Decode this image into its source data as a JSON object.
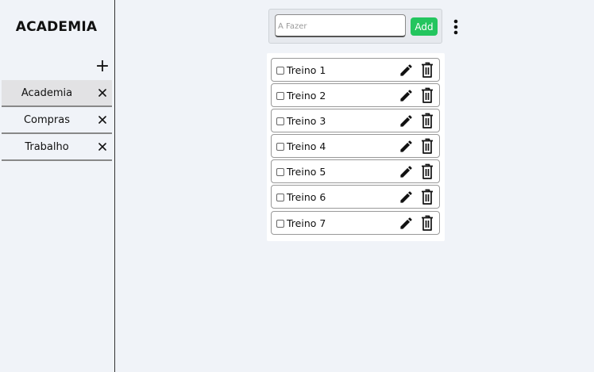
{
  "sidebar": {
    "title": "ACADEMIA",
    "add_list_label": "+",
    "lists": [
      {
        "label": "Academia",
        "active": true
      },
      {
        "label": "Compras",
        "active": false
      },
      {
        "label": "Trabalho",
        "active": false
      }
    ]
  },
  "input_bar": {
    "placeholder": "À Fazer",
    "value": "",
    "add_label": "Add"
  },
  "todos": [
    {
      "label": "Treino 1",
      "checked": false
    },
    {
      "label": "Treino 2",
      "checked": false
    },
    {
      "label": "Treino 3",
      "checked": false
    },
    {
      "label": "Treino 4",
      "checked": false
    },
    {
      "label": "Treino 5",
      "checked": false
    },
    {
      "label": "Treino 6",
      "checked": false
    },
    {
      "label": "Treino 7",
      "checked": false
    }
  ],
  "icons": {
    "add_list": "plus-icon",
    "close": "close-icon",
    "menu": "kebab-menu-icon",
    "edit": "pencil-icon",
    "delete": "trash-icon"
  },
  "colors": {
    "background": "#f0f3f8",
    "accent": "#23c55e",
    "active_list": "#e2e2e4"
  }
}
